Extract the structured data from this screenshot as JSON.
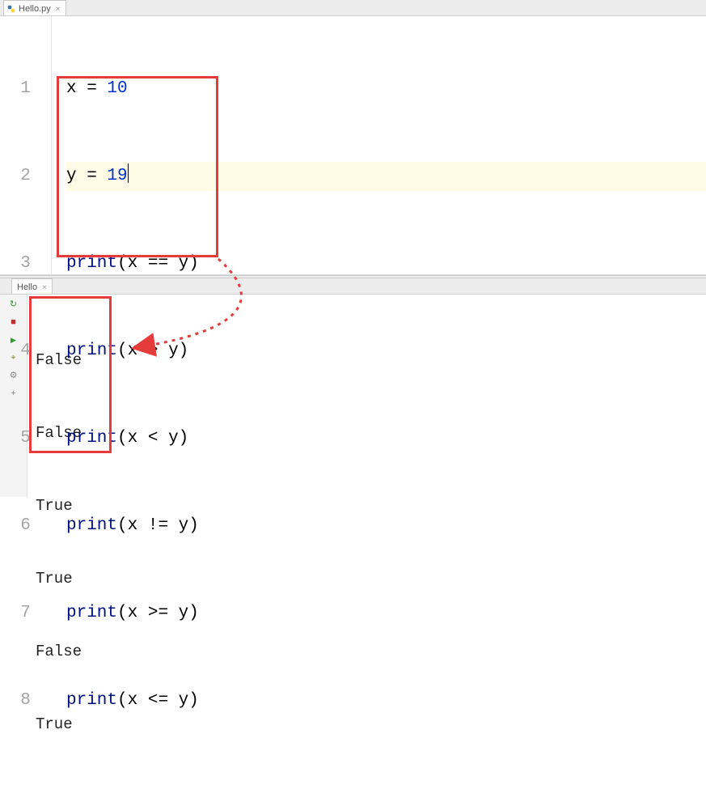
{
  "editor_tab": {
    "filename": "Hello.py"
  },
  "code": {
    "l1": {
      "var": "x",
      "assign": " = ",
      "num": "10"
    },
    "l2": {
      "var": "y",
      "assign": " = ",
      "num": "19"
    },
    "print_name": "print",
    "a": "x",
    "b": "y",
    "ops": [
      "==",
      ">",
      "<",
      "!=",
      ">=",
      "<="
    ]
  },
  "console_tab": {
    "name": "Hello"
  },
  "output": [
    "False",
    "False",
    "True",
    "True",
    "False",
    "True"
  ],
  "colors": {
    "annotation": "#e63b3b",
    "number": "#0033cc",
    "builtin": "#001080",
    "current_line_bg": "#fffbe6"
  }
}
